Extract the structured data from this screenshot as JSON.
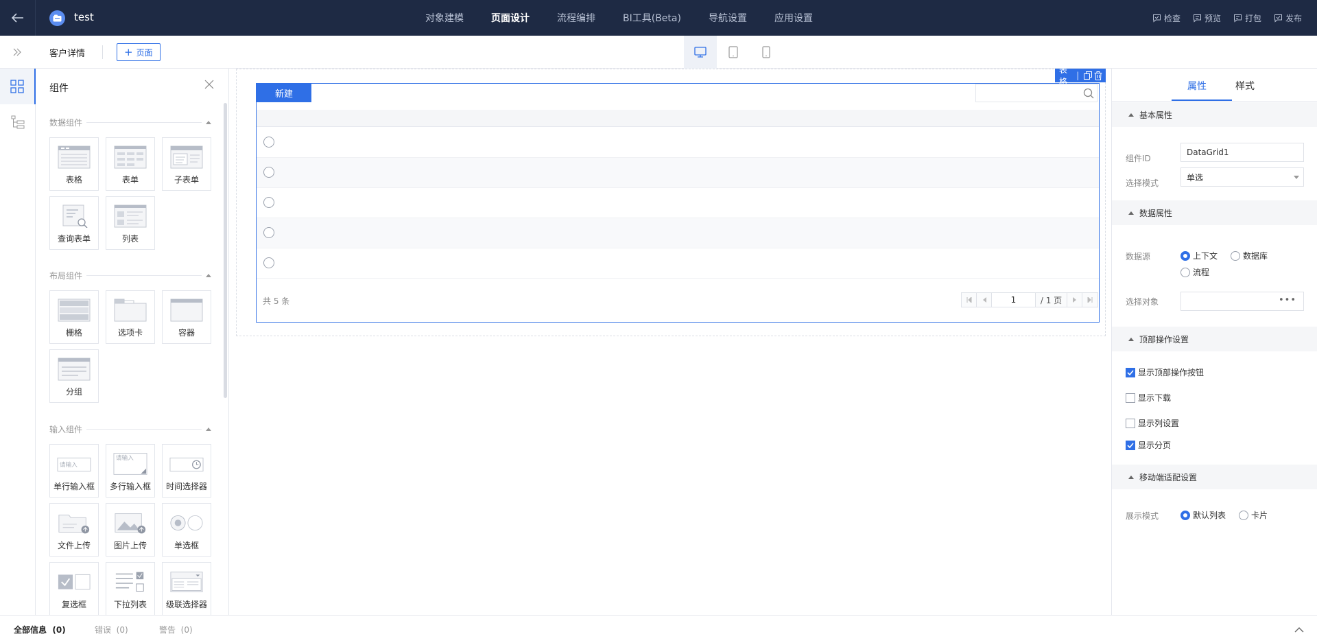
{
  "topbar": {
    "app_name": "test",
    "nav": [
      {
        "label": "对象建模",
        "active": false
      },
      {
        "label": "页面设计",
        "active": true
      },
      {
        "label": "流程编排",
        "active": false
      },
      {
        "label": "BI工具(Beta)",
        "active": false
      },
      {
        "label": "导航设置",
        "active": false
      },
      {
        "label": "应用设置",
        "active": false
      }
    ],
    "actions": [
      {
        "label": "检查",
        "icon": "check-icon"
      },
      {
        "label": "预览",
        "icon": "preview-icon"
      },
      {
        "label": "打包",
        "icon": "package-icon"
      },
      {
        "label": "发布",
        "icon": "publish-icon"
      }
    ]
  },
  "subbar": {
    "page_name": "客户详情",
    "add_page_label": "页面",
    "devices": [
      {
        "name": "desktop-icon",
        "active": true
      },
      {
        "name": "tablet-icon",
        "active": false
      },
      {
        "name": "mobile-icon",
        "active": false
      }
    ]
  },
  "components": {
    "title": "组件",
    "groups": [
      {
        "title": "数据组件",
        "items": [
          {
            "label": "表格",
            "icon": "table-icon"
          },
          {
            "label": "表单",
            "icon": "form-icon"
          },
          {
            "label": "子表单",
            "icon": "subform-icon"
          },
          {
            "label": "查询表单",
            "icon": "query-form-icon"
          },
          {
            "label": "列表",
            "icon": "list-icon"
          }
        ]
      },
      {
        "title": "布局组件",
        "items": [
          {
            "label": "栅格",
            "icon": "grid-layout-icon"
          },
          {
            "label": "选项卡",
            "icon": "tabs-icon"
          },
          {
            "label": "容器",
            "icon": "container-icon"
          },
          {
            "label": "分组",
            "icon": "group-icon"
          }
        ]
      },
      {
        "title": "输入组件",
        "items": [
          {
            "label": "单行输入框",
            "icon": "single-line-input-icon",
            "hint": "请输入"
          },
          {
            "label": "多行输入框",
            "icon": "multi-line-input-icon",
            "hint": "请输入"
          },
          {
            "label": "时间选择器",
            "icon": "time-picker-icon"
          },
          {
            "label": "文件上传",
            "icon": "file-upload-icon"
          },
          {
            "label": "图片上传",
            "icon": "image-upload-icon"
          },
          {
            "label": "单选框",
            "icon": "radio-icon"
          },
          {
            "label": "复选框",
            "icon": "checkbox-icon"
          },
          {
            "label": "下拉列表",
            "icon": "dropdown-list-icon"
          },
          {
            "label": "级联选择器",
            "icon": "cascader-icon"
          }
        ]
      }
    ]
  },
  "canvas": {
    "selected_tag": "表格",
    "new_button": "新建",
    "rows": 5,
    "total_text": "共 5 条",
    "pager": {
      "page": "1",
      "total_pages": "/ 1 页"
    }
  },
  "properties": {
    "tabs": [
      {
        "label": "属性",
        "active": true
      },
      {
        "label": "样式",
        "active": false
      }
    ],
    "sections": {
      "basic": "基本属性",
      "data": "数据属性",
      "top_ops": "顶部操作设置",
      "mobile": "移动端适配设置"
    },
    "component_id_label": "组件ID",
    "component_id_value": "DataGrid1",
    "select_mode_label": "选择模式",
    "select_mode_value": "单选",
    "datasource_label": "数据源",
    "datasource_options": [
      {
        "label": "上下文",
        "checked": true
      },
      {
        "label": "数据库",
        "checked": false
      },
      {
        "label": "流程",
        "checked": false
      }
    ],
    "select_object_label": "选择对象",
    "select_object_value": "",
    "checkboxes": [
      {
        "label": "显示顶部操作按钮",
        "checked": true
      },
      {
        "label": "显示下载",
        "checked": false
      },
      {
        "label": "显示列设置",
        "checked": false
      },
      {
        "label": "显示分页",
        "checked": true
      }
    ],
    "display_mode_label": "展示模式",
    "display_mode_options": [
      {
        "label": "默认列表",
        "checked": true
      },
      {
        "label": "卡片",
        "checked": false
      }
    ]
  },
  "bottombar": {
    "tabs": [
      {
        "label": "全部信息",
        "count": "(0)",
        "active": true
      },
      {
        "label": "错误",
        "count": "(0)",
        "active": false
      },
      {
        "label": "警告",
        "count": "(0)",
        "active": false
      }
    ]
  }
}
